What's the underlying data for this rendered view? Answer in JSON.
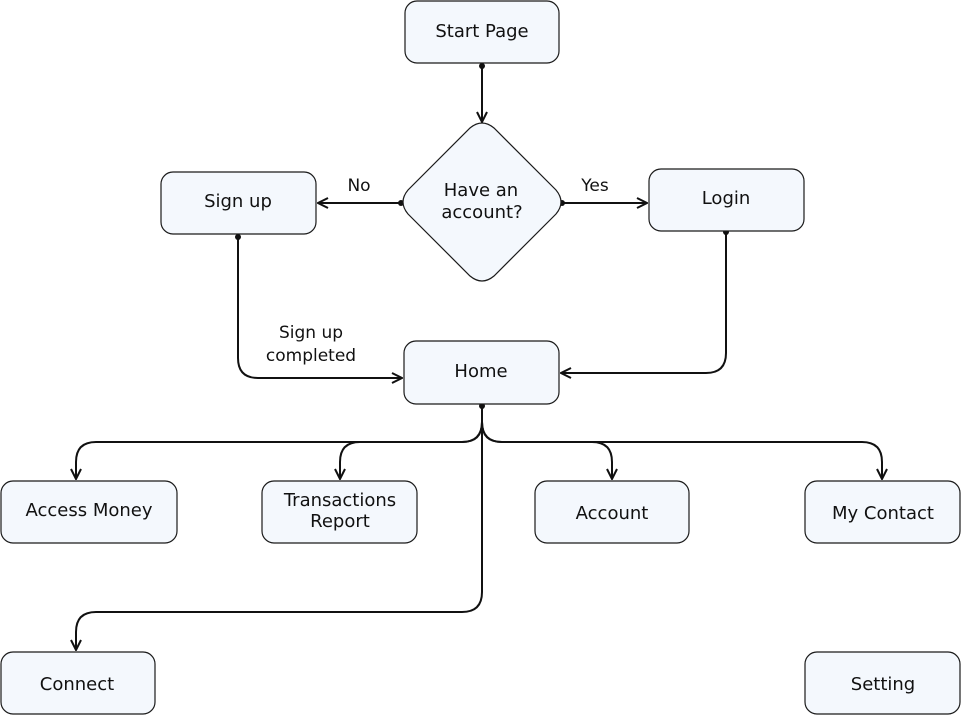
{
  "nodes": {
    "start": "Start Page",
    "decision_line1": "Have an",
    "decision_line2": "account?",
    "signup": "Sign up",
    "login": "Login",
    "home": "Home",
    "access_money": "Access Money",
    "transactions_line1": "Transactions",
    "transactions_line2": "Report",
    "account": "Account",
    "my_contact": "My Contact",
    "connect": "Connect",
    "setting": "Setting"
  },
  "edges": {
    "no": "No",
    "yes": "Yes",
    "signup_completed_line1": "Sign up",
    "signup_completed_line2": "completed"
  },
  "colors": {
    "node_fill": "#f4f8fd",
    "stroke": "#111111"
  }
}
